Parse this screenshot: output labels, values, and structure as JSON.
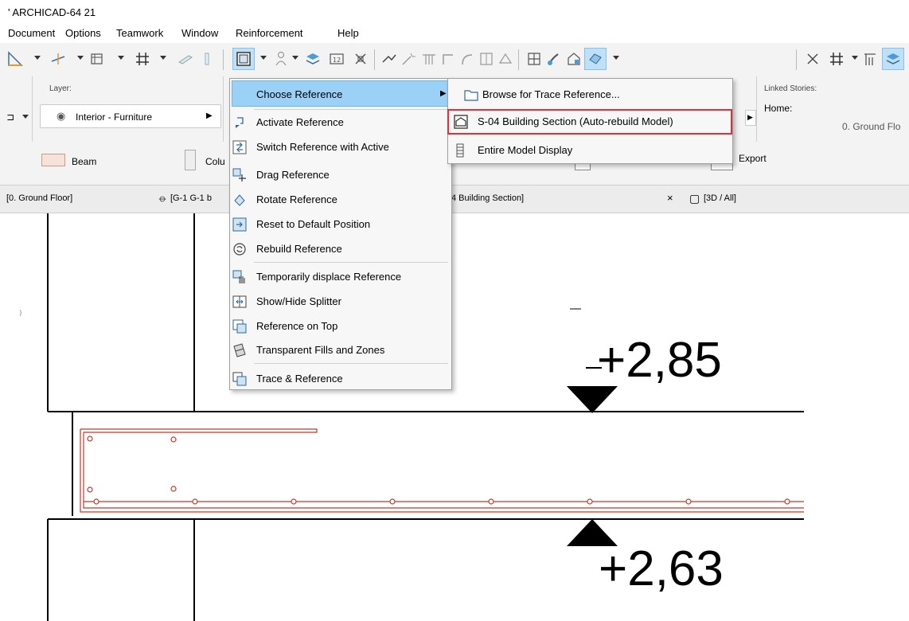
{
  "app": {
    "title": "' ARCHICAD-64 21"
  },
  "menubar": [
    "Document",
    "Options",
    "Teamwork",
    "Window",
    "Reinforcement",
    "Help"
  ],
  "info_box": {
    "layer_label": "Layer:",
    "layer_value": "Interior - Furniture",
    "linked_stories_label": "Linked Stories:",
    "home_label": "Home:",
    "home_value": "0. Ground Flo"
  },
  "tools": {
    "beam": "Beam",
    "column": "Colu",
    "export": "Export"
  },
  "tabs": [
    "[0. Ground Floor]",
    "[G-1 G-1 b",
    "4 Building Section]",
    "×",
    "[3D / All]"
  ],
  "reference_menu": {
    "items": [
      {
        "label": "Choose Reference",
        "icon": "none",
        "submenu": true,
        "highlighted": true
      },
      {
        "label": "Activate Reference",
        "icon": "activate-reference-icon"
      },
      {
        "label": "Switch Reference with Active",
        "icon": "switch-reference-icon"
      },
      {
        "label": "Drag Reference",
        "icon": "drag-reference-icon"
      },
      {
        "label": "Rotate Reference",
        "icon": "rotate-reference-icon"
      },
      {
        "label": "Reset to Default Position",
        "icon": "reset-position-icon"
      },
      {
        "label": "Rebuild Reference",
        "icon": "rebuild-reference-icon"
      },
      {
        "label": "Temporarily displace Reference",
        "icon": "hand-displace-icon"
      },
      {
        "label": "Show/Hide Splitter",
        "icon": "splitter-icon"
      },
      {
        "label": "Reference on Top",
        "icon": "reference-on-top-icon"
      },
      {
        "label": "Transparent Fills and Zones",
        "icon": "transparent-fills-icon"
      },
      {
        "label": "Trace & Reference",
        "icon": "trace-reference-icon"
      }
    ]
  },
  "choose_reference_submenu": {
    "items": [
      {
        "label": "Browse for Trace Reference...",
        "icon": "folder-icon"
      },
      {
        "label": "S-04 Building Section (Auto-rebuild Model)",
        "icon": "section-icon",
        "outlined": true
      },
      {
        "label": "Entire Model Display",
        "icon": "model-display-icon"
      }
    ]
  },
  "drawing": {
    "elevation_top": "+2,85",
    "elevation_bottom": "+2,63"
  },
  "colors": {
    "highlight": "#9bd0f7",
    "outline": "#d9323a",
    "rebar": "#c0392b",
    "toolbar_active": "#bfe0f7"
  }
}
